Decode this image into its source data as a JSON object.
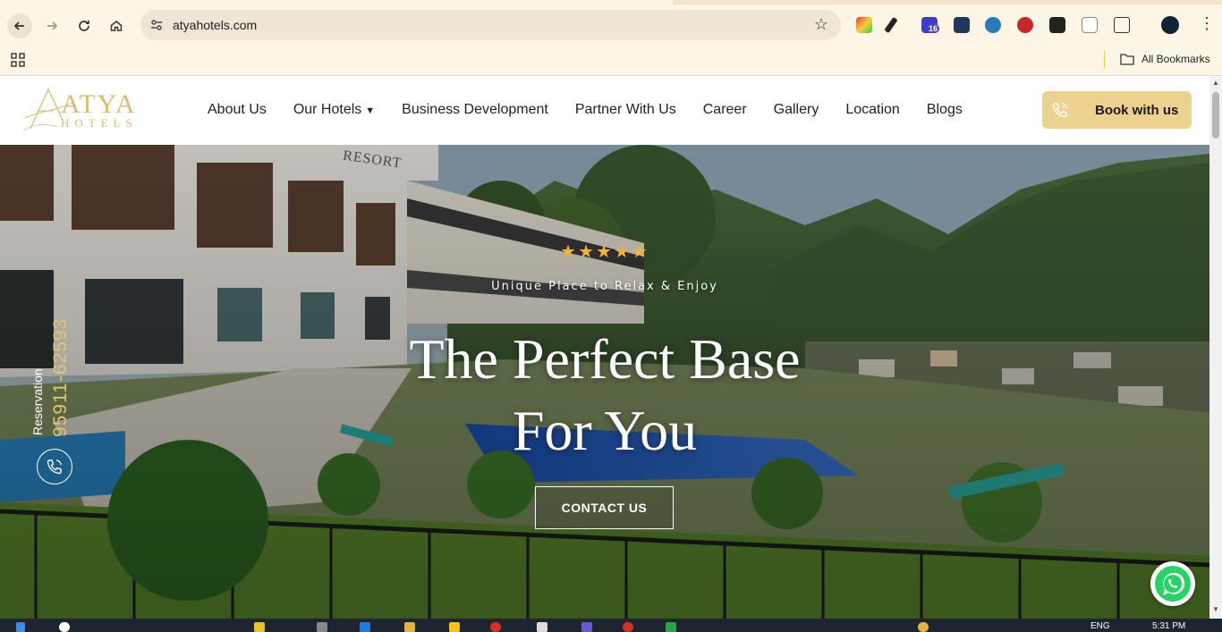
{
  "browser": {
    "url": "atyahotels.com",
    "bookmarks_all_label": "All Bookmarks",
    "extension_badge": "16"
  },
  "header": {
    "logo_text": "ATYA",
    "logo_subtext": "HOTELS",
    "menu": [
      {
        "label": "About Us"
      },
      {
        "label": "Our Hotels",
        "has_dropdown": true
      },
      {
        "label": "Business Development"
      },
      {
        "label": "Partner With Us"
      },
      {
        "label": "Career"
      },
      {
        "label": "Gallery"
      },
      {
        "label": "Location"
      },
      {
        "label": "Blogs"
      }
    ],
    "book_button_label": "Book with us"
  },
  "hero": {
    "stars": "★★★★★",
    "rating": 5,
    "tagline": "Unique Place to Relax & Enjoy",
    "headline_line1": "The Perfect Base",
    "headline_line2": "For You",
    "cta_label": "CONTACT US",
    "resort_sign": "RESORT"
  },
  "reservation": {
    "label": "Reservation",
    "phone": "95911-62593"
  },
  "taskbar": {
    "lang": "ENG",
    "time": "5:31 PM"
  },
  "colors": {
    "chrome_bg": "#fdf6e6",
    "gold_accent": "#ecd28e",
    "logo_gold": "#d8bd72",
    "star_color": "#f0b43c",
    "whatsapp_green": "#25d366"
  }
}
